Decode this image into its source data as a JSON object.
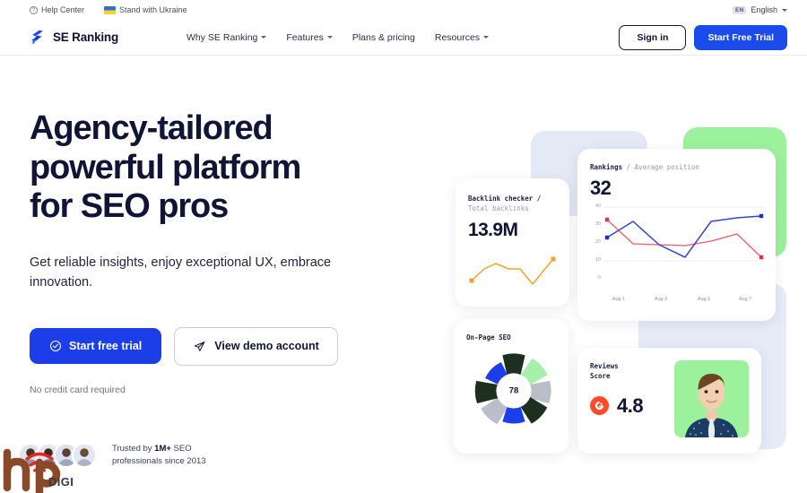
{
  "utility_bar": {
    "help_center": "Help Center",
    "help_icon": "question-circle-icon",
    "ukraine": "Stand with Ukraine",
    "ukraine_icon": "ukraine-flag-icon",
    "language_badge": "EN",
    "language_label": "English",
    "language_caret": "chevron-down-icon"
  },
  "nav": {
    "brand": "SE Ranking",
    "brand_icon": "se-ranking-bolt-logo",
    "links": [
      {
        "label": "Why SE Ranking",
        "has_caret": true
      },
      {
        "label": "Features",
        "has_caret": true
      },
      {
        "label": "Plans & pricing",
        "has_caret": false
      },
      {
        "label": "Resources",
        "has_caret": true
      }
    ],
    "sign_in": "Sign in",
    "start_trial": "Start Free Trial"
  },
  "hero": {
    "title_line1": "Agency-tailored",
    "title_line2": "powerful platform",
    "title_line3": "for SEO pros",
    "subtitle": "Get reliable insights, enjoy exceptional UX, embrace innovation.",
    "cta_primary": "Start free trial",
    "cta_primary_icon": "check-circle-icon",
    "cta_secondary": "View demo account",
    "cta_secondary_icon": "paper-plane-icon",
    "no_credit_card": "No credit card required"
  },
  "trust": {
    "line1_prefix": "Trusted by ",
    "line1_bold": "1M+",
    "line1_suffix": " SEO",
    "line2": "professionals since 2013",
    "avatar_count": 4
  },
  "watermark": {
    "text": "DIGI",
    "mark": "hp-digi-watermark-logo"
  },
  "dashboard": {
    "backlinks": {
      "label_bold": "Backlink checker /",
      "label_muted": "Total backlinks",
      "value": "13.9M",
      "accent": "#f0a328"
    },
    "rankings": {
      "label_bold": "Rankings",
      "label_sep": "/",
      "label_muted": "Average position",
      "value": "32"
    },
    "onpage": {
      "label": "On-Page SEO",
      "score": "78"
    },
    "reviews": {
      "label_line1": "Reviews",
      "label_line2": "Score",
      "badge_icon": "g2-logo-icon",
      "badge_color": "#ff492c",
      "score": "4.8",
      "photo": "person-portrait-photo"
    }
  },
  "chart_data": [
    {
      "type": "line",
      "title": "Rankings / Average position",
      "headline_value": 32,
      "x": [
        "Aug 1",
        "Aug 2",
        "Aug 3",
        "Aug 4",
        "Aug 5",
        "Aug 6",
        "Aug 7"
      ],
      "tick_labels": [
        "Aug 1",
        "Aug 3",
        "Aug 5",
        "Aug 7"
      ],
      "ylim": [
        0,
        40
      ],
      "yticks": [
        0,
        10,
        20,
        30,
        40
      ],
      "xlabel": "",
      "ylabel": "",
      "grid": true,
      "legend": "none",
      "series": [
        {
          "name": "series-blue",
          "color": "#2f3fd8",
          "values": [
            23,
            32,
            19,
            12,
            32,
            34,
            35
          ]
        },
        {
          "name": "series-red",
          "color": "#ef5a6a",
          "values": [
            33,
            19.5,
            19,
            18.5,
            21,
            25,
            12
          ]
        }
      ]
    },
    {
      "type": "line",
      "title": "Backlink checker / Total backlinks",
      "headline_value": "13.9M",
      "x": [
        1,
        2,
        3,
        4,
        5,
        6,
        7
      ],
      "ylim": [
        0,
        10
      ],
      "grid": false,
      "legend": "none",
      "series": [
        {
          "name": "backlinks-sparkline",
          "color": "#f0a328",
          "values": [
            3.0,
            5.6,
            6.6,
            5.9,
            5.9,
            2.6,
            5.2,
            7.6
          ]
        }
      ]
    },
    {
      "type": "pie",
      "title": "On-Page SEO",
      "center_value": 78,
      "grid": false,
      "legend": "none",
      "labels": [
        "seg-1",
        "seg-2",
        "seg-3",
        "seg-4",
        "seg-5",
        "seg-6",
        "seg-7",
        "seg-8"
      ],
      "values": [
        12.5,
        12.5,
        12.5,
        12.5,
        12.5,
        12.5,
        12.5,
        12.5
      ],
      "colors": [
        "#1d3020",
        "#a8efac",
        "#b9bec9",
        "#1d3020",
        "#1b3ee8",
        "#b9bec9",
        "#1d3020",
        "#1b3ee8"
      ]
    }
  ]
}
